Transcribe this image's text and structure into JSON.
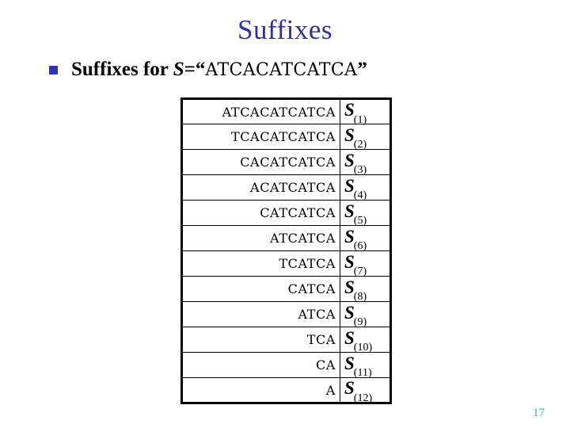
{
  "slide": {
    "title": "Suffixes",
    "title_color": "#33338a",
    "page_number": "17",
    "page_number_color": "#3cb99a",
    "background_color": "#ffffff"
  },
  "bullet": {
    "marker": "square-bullet",
    "marker_color": "#3333b0",
    "text_prefix": "Suffixes for ",
    "variable": "S",
    "equals": "=",
    "open_quote": "“",
    "sequence": "ATCACATCATCA",
    "close_quote": "”"
  },
  "table": {
    "border_color": "#000000",
    "rows": [
      {
        "suffix": "ATCACATCATCA",
        "symbol": "S",
        "index": "(1)"
      },
      {
        "suffix": "TCACATCATCA",
        "symbol": "S",
        "index": "(2)"
      },
      {
        "suffix": "CACATCATCA",
        "symbol": "S",
        "index": "(3)"
      },
      {
        "suffix": "ACATCATCA",
        "symbol": "S",
        "index": "(4)"
      },
      {
        "suffix": "CATCATCA",
        "symbol": "S",
        "index": "(5)"
      },
      {
        "suffix": "ATCATCA",
        "symbol": "S",
        "index": "(6)"
      },
      {
        "suffix": "TCATCA",
        "symbol": "S",
        "index": "(7)"
      },
      {
        "suffix": "CATCA",
        "symbol": "S",
        "index": "(8)"
      },
      {
        "suffix": "ATCA",
        "symbol": "S",
        "index": "(9)"
      },
      {
        "suffix": "TCA",
        "symbol": "S",
        "index": "(10)"
      },
      {
        "suffix": "CA",
        "symbol": "S",
        "index": "(11)"
      },
      {
        "suffix": "A",
        "symbol": "S",
        "index": "(12)"
      }
    ]
  }
}
